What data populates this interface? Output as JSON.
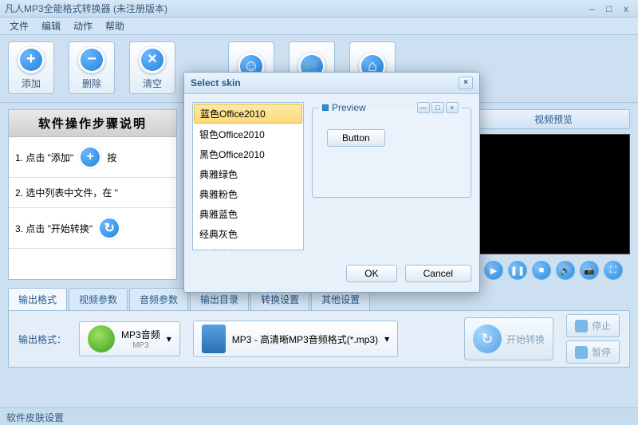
{
  "window": {
    "title": "凡人MP3全能格式转换器    (未注册版本)"
  },
  "menu": {
    "file": "文件",
    "edit": "编辑",
    "action": "动作",
    "help": "帮助"
  },
  "toolbar": {
    "add": "添加",
    "remove": "删除",
    "clear": "清空",
    "b4": "",
    "b5": "",
    "b6": ""
  },
  "steps": {
    "header": "软件操作步骤说明",
    "s1": "1. 点击 \"添加\"",
    "s1b": "按",
    "s2": "2. 选中列表中文件，在 \"",
    "s3": "3. 点击 \"开始转换\""
  },
  "preview": {
    "header": "视频预览"
  },
  "tabs": {
    "t1": "输出格式",
    "t2": "视频参数",
    "t3": "音频参数",
    "t4": "输出目录",
    "t5": "转换设置",
    "t6": "其他设置"
  },
  "output": {
    "label": "输出格式：",
    "fmt1_top": "MP3音频",
    "fmt1_bot": "MP3",
    "fmt2": "MP3 - 高清晰MP3音频格式(*.mp3)",
    "convert": "开始转换",
    "stop": "停止",
    "pause": "暂停"
  },
  "status": "软件皮肤设置",
  "dialog": {
    "title": "Select skin",
    "skins": [
      "蓝色Office2010",
      "银色Office2010",
      "黑色Office2010",
      "典雅绿色",
      "典雅粉色",
      "典雅蓝色",
      "经典灰色",
      "经典蓝色"
    ],
    "preview_label": "Preview",
    "button_label": "Button",
    "ok": "OK",
    "cancel": "Cancel"
  }
}
